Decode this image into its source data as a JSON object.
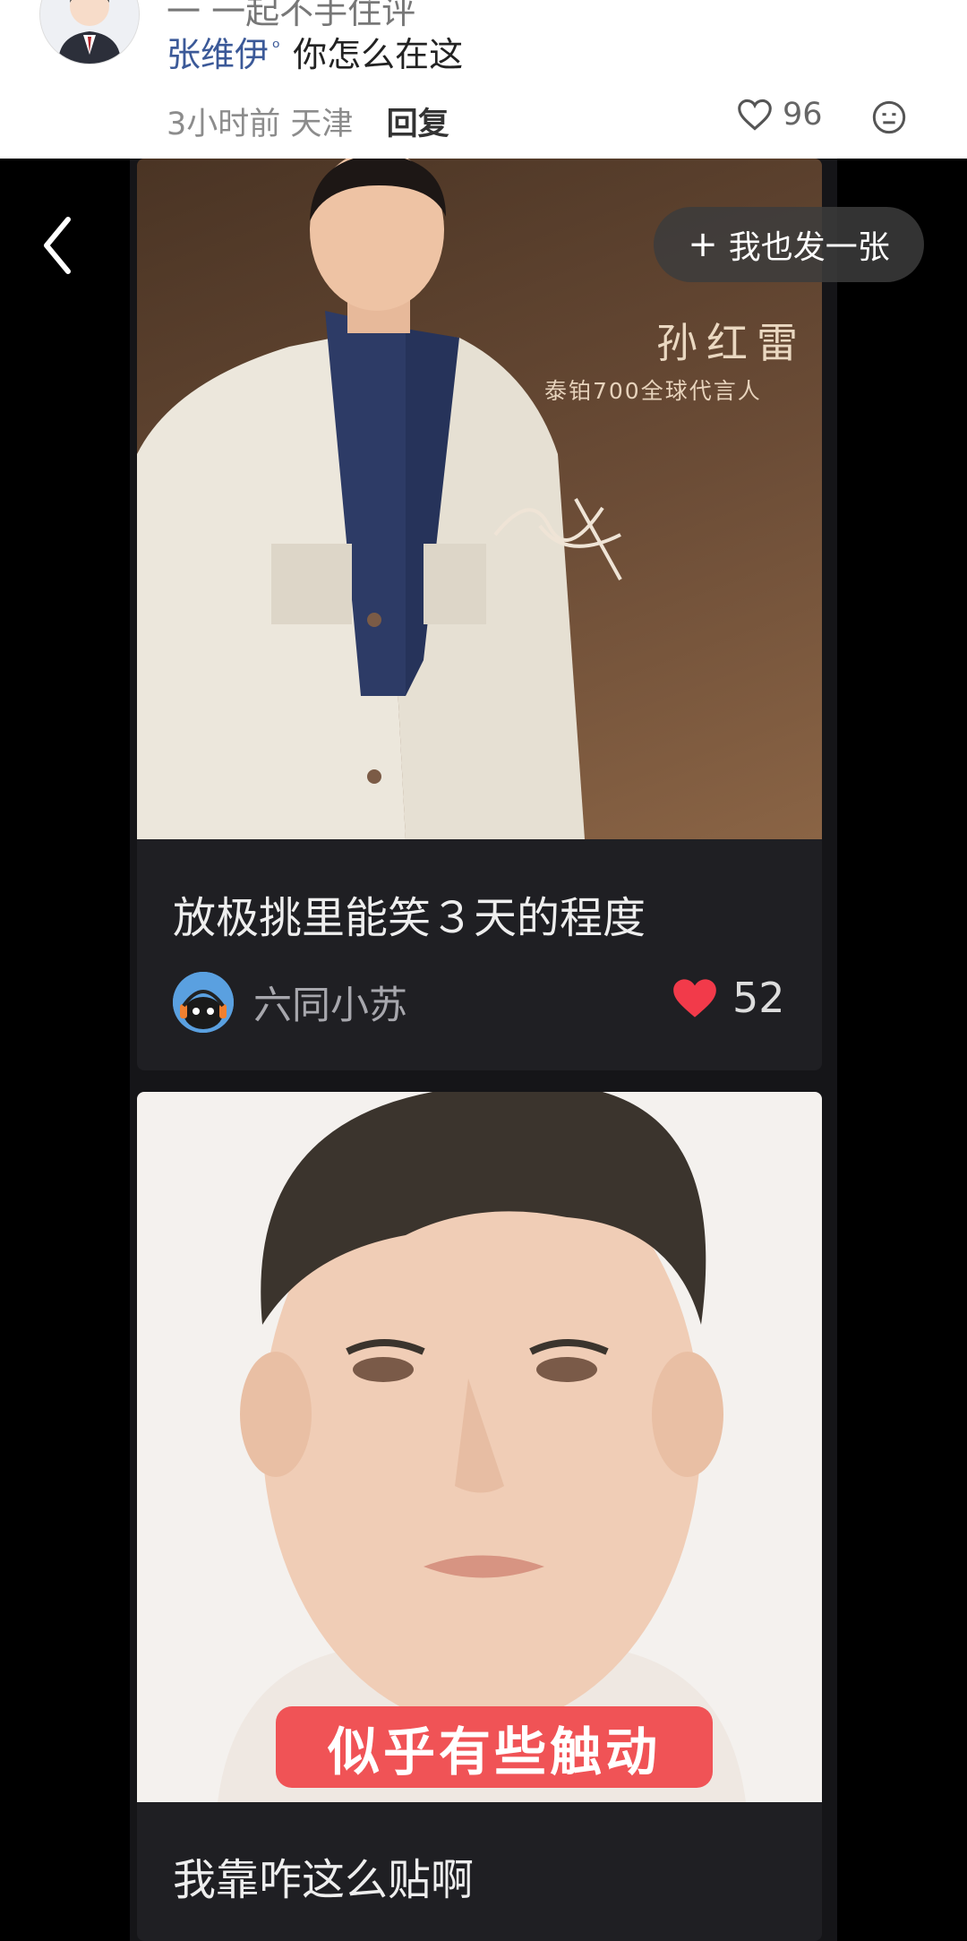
{
  "comment": {
    "cut_text": "一 一起不手住评",
    "username": "张维伊",
    "text": "你怎么在这",
    "time": "3小时前",
    "location": "天津",
    "reply_label": "回复",
    "likes": "96"
  },
  "viewer": {
    "post_button_label": "我也发一张",
    "cards": [
      {
        "overlay_name": "孙红雷",
        "overlay_sub": "泰铂700全球代言人",
        "caption": "放极挑里能笑３天的程度",
        "author": "六同小苏",
        "likes": "52"
      },
      {
        "sticker": "似乎有些触动",
        "caption": "我靠咋这么贴啊"
      }
    ]
  },
  "colors": {
    "like_red": "#f23a4a",
    "link_blue": "#3b5998",
    "card_bg": "#1f1f23"
  }
}
